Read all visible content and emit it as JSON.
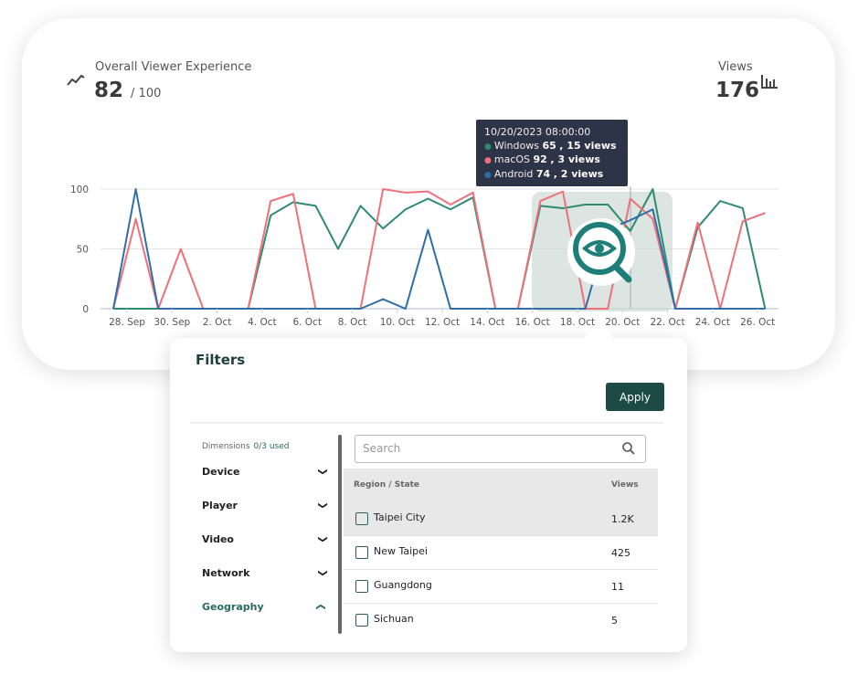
{
  "header": {
    "experience_title": "Overall Viewer Experience",
    "experience_score": "82",
    "experience_max": "/ 100",
    "views_title": "Views",
    "views_value": "176",
    "icons": [
      "trend-line-icon",
      "bar-chart-icon"
    ]
  },
  "tooltip": {
    "title": "10/20/2023 08:00:00",
    "rows": [
      {
        "series": "Windows",
        "value": "65",
        "views": ", 15 views"
      },
      {
        "series": "macOS",
        "value": "92",
        "views": ", 3 views"
      },
      {
        "series": "Android",
        "value": "74",
        "views": ", 2 views"
      }
    ]
  },
  "chart_data": {
    "type": "line",
    "x": [
      "2023-09-27",
      "2023-09-28",
      "2023-09-29",
      "2023-09-30",
      "2023-10-01",
      "2023-10-02",
      "2023-10-03",
      "2023-10-04",
      "2023-10-05",
      "2023-10-06",
      "2023-10-07",
      "2023-10-08",
      "2023-10-09",
      "2023-10-10",
      "2023-10-11",
      "2023-10-12",
      "2023-10-13",
      "2023-10-14",
      "2023-10-15",
      "2023-10-16",
      "2023-10-17",
      "2023-10-18",
      "2023-10-19",
      "2023-10-20",
      "2023-10-21",
      "2023-10-22",
      "2023-10-23",
      "2023-10-24",
      "2023-10-25",
      "2023-10-26"
    ],
    "x_tick_labels": [
      "28. Sep",
      "30. Sep",
      "2. Oct",
      "4. Oct",
      "6. Oct",
      "8. Oct",
      "10. Oct",
      "12. Oct",
      "14. Oct",
      "16. Oct",
      "18. Oct",
      "20. Oct",
      "22. Oct",
      "24. Oct",
      "26. Oct"
    ],
    "y_tick_labels": [
      "0",
      "50",
      "100"
    ],
    "ylim": [
      0,
      100
    ],
    "grid": true,
    "series": [
      {
        "name": "Windows",
        "color": "#2e8b6e",
        "values": [
          0,
          0,
          0,
          0,
          0,
          0,
          0,
          78,
          89,
          86,
          50,
          86,
          67,
          83,
          92,
          83,
          93,
          0,
          0,
          86,
          84,
          87,
          87,
          65,
          100,
          0,
          68,
          90,
          84,
          0
        ]
      },
      {
        "name": "macOS",
        "color": "#f0707a",
        "values": [
          0,
          75,
          0,
          50,
          0,
          0,
          0,
          90,
          96,
          0,
          0,
          0,
          100,
          97,
          98,
          87,
          97,
          0,
          0,
          90,
          98,
          0,
          0,
          92,
          75,
          0,
          72,
          0,
          73,
          80
        ]
      },
      {
        "name": "Android",
        "color": "#2f6fa6",
        "values": [
          0,
          100,
          0,
          0,
          0,
          0,
          0,
          0,
          0,
          0,
          0,
          0,
          8,
          0,
          66,
          0,
          0,
          0,
          0,
          0,
          0,
          0,
          66,
          74,
          83,
          0,
          0,
          0,
          0,
          0
        ]
      }
    ],
    "highlight_range": [
      "2023-10-16",
      "2023-10-21"
    ]
  },
  "filters": {
    "title": "Filters",
    "apply_label": "Apply",
    "dimensions_label": "Dimensions",
    "dimensions_used": "0/3 used",
    "dimensions": [
      {
        "label": "Device",
        "expanded": false
      },
      {
        "label": "Player",
        "expanded": false
      },
      {
        "label": "Video",
        "expanded": false
      },
      {
        "label": "Network",
        "expanded": false
      },
      {
        "label": "Geography",
        "expanded": true
      }
    ],
    "search_placeholder": "Search",
    "table": {
      "col_region": "Region / State",
      "col_views": "Views",
      "rows": [
        {
          "name": "Taipei City",
          "views": "1.2K"
        },
        {
          "name": "New Taipei",
          "views": "425"
        },
        {
          "name": "Guangdong",
          "views": "11"
        },
        {
          "name": "Sichuan",
          "views": "5"
        }
      ]
    }
  },
  "colors": {
    "accent": "#1e4a45",
    "windows": "#2e8b6e",
    "macos": "#f0707a",
    "android": "#2f6fa6"
  }
}
